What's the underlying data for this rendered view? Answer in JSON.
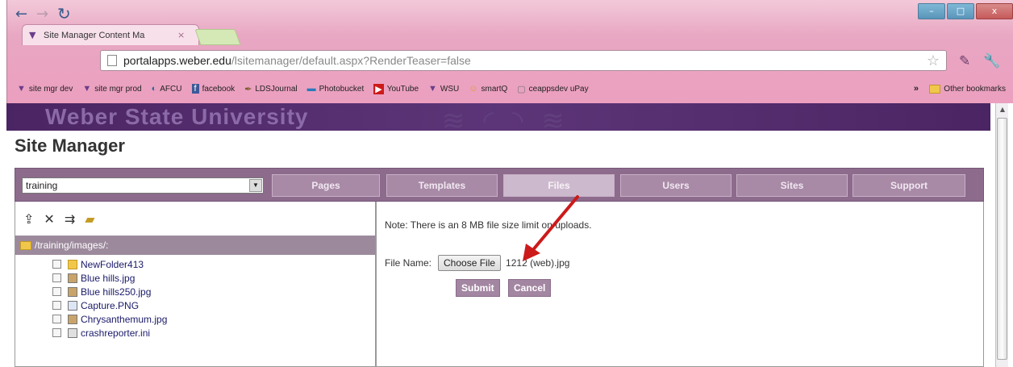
{
  "browser": {
    "tab_title": "Site Manager Content Ma",
    "tab_close": "×",
    "url_host": "portalapps.weber.edu",
    "url_path": "/lsitemanager/default.aspx?RenderTeaser=false",
    "window_controls": [
      "–",
      "□",
      "x"
    ]
  },
  "bookmarks": {
    "items": [
      {
        "icon": "W-icon",
        "label": "site mgr dev"
      },
      {
        "icon": "W-icon",
        "label": "site mgr prod"
      },
      {
        "icon": "afcu-icon",
        "label": "AFCU"
      },
      {
        "icon": "facebook-icon",
        "label": "facebook"
      },
      {
        "icon": "lds-icon",
        "label": "LDSJournal"
      },
      {
        "icon": "photobucket-icon",
        "label": "Photobucket"
      },
      {
        "icon": "youtube-icon",
        "label": "YouTube"
      },
      {
        "icon": "W-icon",
        "label": "WSU"
      },
      {
        "icon": "smartq-icon",
        "label": "smartQ"
      },
      {
        "icon": "page-icon",
        "label": "ceappsdev uPay"
      }
    ],
    "more": "»",
    "other": "Other bookmarks"
  },
  "page": {
    "banner": "Weber State University",
    "title": "Site Manager"
  },
  "navbar": {
    "site_select": "training",
    "tabs": [
      {
        "label": "Pages"
      },
      {
        "label": "Templates"
      },
      {
        "label": "Files",
        "active": true
      },
      {
        "label": "Users"
      },
      {
        "label": "Sites"
      },
      {
        "label": "Support"
      }
    ]
  },
  "left_panel": {
    "path": "/training/images/:",
    "files": [
      {
        "name": "NewFolder413",
        "type": "folder"
      },
      {
        "name": "Blue hills.jpg",
        "type": "img"
      },
      {
        "name": "Blue hills250.jpg",
        "type": "img"
      },
      {
        "name": "Capture.PNG",
        "type": "png"
      },
      {
        "name": "Chrysanthemum.jpg",
        "type": "img"
      },
      {
        "name": "crashreporter.ini",
        "type": "ini"
      }
    ]
  },
  "right_panel": {
    "note": "Note: There is an 8 MB file size limit on uploads.",
    "file_label": "File Name:",
    "choose_button": "Choose File",
    "chosen_file": "1212 (web).jpg",
    "submit": "Submit",
    "cancel": "Cancel"
  },
  "colors": {
    "accent_purple": "#8d6b8c",
    "banner_purple": "#4b2563",
    "arrow_red": "#cc1a1a"
  }
}
